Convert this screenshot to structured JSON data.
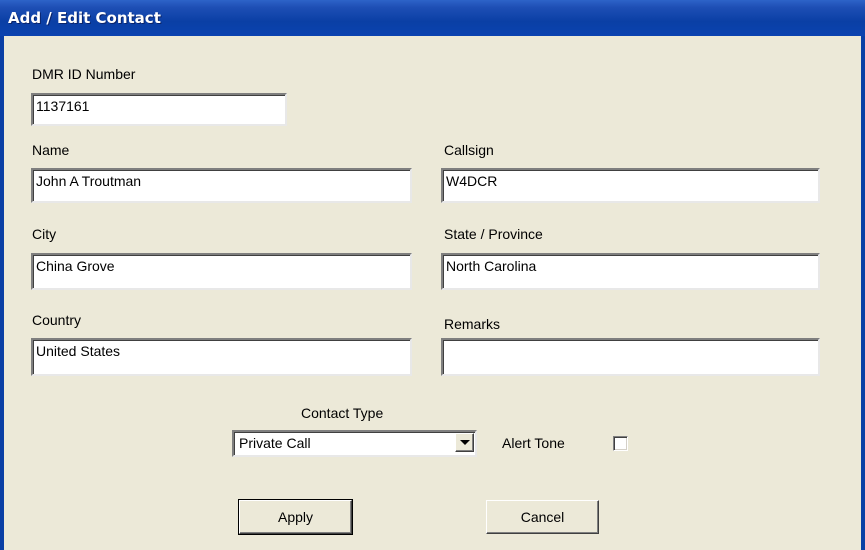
{
  "window": {
    "title": "Add / Edit Contact"
  },
  "fields": {
    "dmr_id": {
      "label": "DMR ID Number",
      "value": "1137161"
    },
    "name": {
      "label": "Name",
      "value": "John A Troutman"
    },
    "callsign": {
      "label": "Callsign",
      "value": "W4DCR"
    },
    "city": {
      "label": "City",
      "value": "China Grove"
    },
    "state": {
      "label": "State / Province",
      "value": "North Carolina"
    },
    "country": {
      "label": "Country",
      "value": "United States"
    },
    "remarks": {
      "label": "Remarks",
      "value": ""
    }
  },
  "contact_type": {
    "label": "Contact Type",
    "selected": "Private Call"
  },
  "alert_tone": {
    "label": "Alert Tone",
    "checked": false
  },
  "buttons": {
    "apply": "Apply",
    "cancel": "Cancel"
  },
  "colors": {
    "titlebar": "#0a3fa5",
    "dialog_bg": "#ece9d8",
    "field_bg": "#ffffff"
  }
}
